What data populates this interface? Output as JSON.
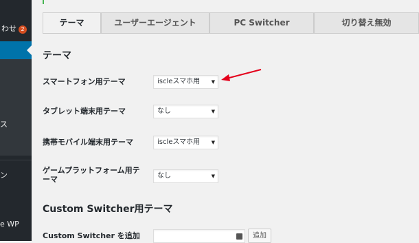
{
  "sidebar": {
    "items": [
      {
        "label": "わせ",
        "badge": "2"
      },
      {
        "label": "ス"
      },
      {
        "label": "ン"
      },
      {
        "label": "e WP"
      }
    ]
  },
  "tabs": [
    {
      "label": "テーマ",
      "active": true
    },
    {
      "label": "ユーザーエージェント"
    },
    {
      "label": "PC Switcher"
    },
    {
      "label": "切り替え無効"
    }
  ],
  "sections": {
    "theme_title": "テーマ",
    "custom_title": "Custom Switcher用テーマ"
  },
  "rows": [
    {
      "label": "スマートフォン用テーマ",
      "value": "iscleスマホ用"
    },
    {
      "label": "タブレット端末用テーマ",
      "value": "なし"
    },
    {
      "label": "携帯モバイル端末用テーマ",
      "value": "iscleスマホ用"
    },
    {
      "label": "ゲームプラットフォーム用テーマ",
      "value": "なし"
    }
  ],
  "custom": {
    "label": "Custom Switcher を追加",
    "input_value": "",
    "add_button": "追加"
  },
  "colors": {
    "sidebar_bg": "#23282d",
    "active_menu": "#0073aa",
    "badge": "#d54e21",
    "annotation_arrow": "#e4001b"
  }
}
